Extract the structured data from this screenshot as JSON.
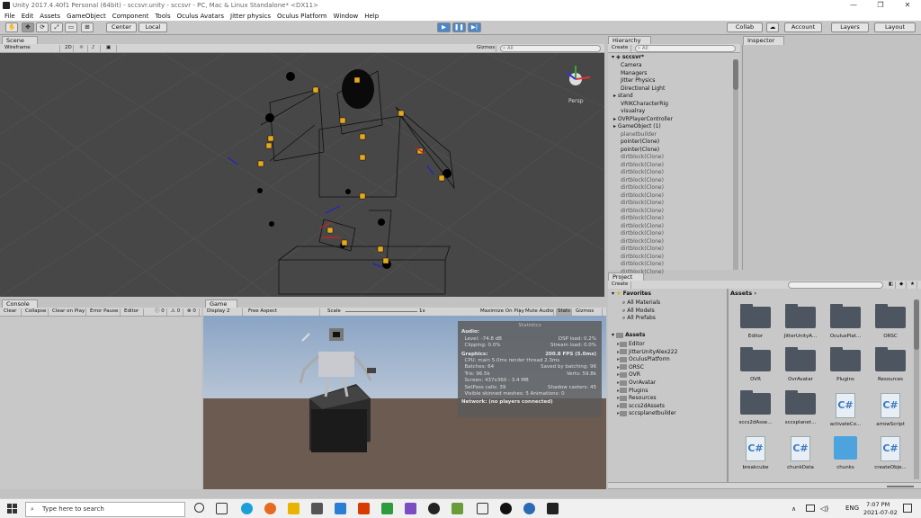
{
  "window": {
    "title": "Unity 2017.4.40f1 Personal (64bit) - sccsvr.unity - sccsvr - PC, Mac & Linux Standalone* <DX11>"
  },
  "menu": [
    "File",
    "Edit",
    "Assets",
    "GameObject",
    "Component",
    "Tools",
    "Oculus Avatars",
    "Jitter physics",
    "Oculus Platform",
    "Window",
    "Help"
  ],
  "toolbar": {
    "center": "Center",
    "local": "Local",
    "collab": "Collab",
    "account": "Account",
    "layers": "Layers",
    "layout": "Layout"
  },
  "scene": {
    "tab": "Scene",
    "shading": "Wireframe",
    "mode2d": "2D",
    "gizmos": "Gizmos",
    "search_placeholder": "All",
    "persp": "Persp"
  },
  "console": {
    "tab": "Console",
    "clear": "Clear",
    "collapse": "Collapse",
    "clear_on_play": "Clear on Play",
    "error_pause": "Error Pause",
    "editor": "Editor",
    "count_info": "0",
    "count_warn": "0",
    "count_err": "0"
  },
  "game": {
    "tab": "Game",
    "display": "Display 2",
    "aspect": "Free Aspect",
    "scale_label": "Scale",
    "scale_value": "1x",
    "maximize": "Maximize On Play",
    "mute": "Mute Audio",
    "stats": "Stats",
    "gizmos": "Gizmos"
  },
  "statistics": {
    "title": "Statistics",
    "audio": "Audio:",
    "level": "Level: -74.8 dB",
    "dsp": "DSP load: 0.2%",
    "clipping": "Clipping: 0.0%",
    "stream": "Stream load: 0.0%",
    "graphics": "Graphics:",
    "fps": "200.8 FPS (5.0ms)",
    "cpu": "CPU: main 5.0ms  render thread 2.3ms",
    "batches": "Batches: 64",
    "saved": "Saved by batching: 96",
    "tris": "Tris: 96.5k",
    "verts": "Verts: 59.8k",
    "screen": "Screen: 437x360 - 3.4 MB",
    "setpass": "SetPass calls: 39",
    "shadow": "Shadow casters: 45",
    "skinned": "Visible skinned meshes: 5  Animations: 0",
    "network": "Network: (no players connected)"
  },
  "hierarchy": {
    "tab": "Hierarchy",
    "create": "Create",
    "search_placeholder": "All",
    "scene_name": "sccsvr*",
    "items": [
      "Camera",
      "Managers",
      "Jitter Physics",
      "Directional Light",
      "stand",
      "VRIKCharacterRig",
      "visualray",
      "OVRPlayerController",
      "GameObject (1)",
      "planetbuilder",
      "pointer(Clone)",
      "pointer(Clone)",
      "dirtblock(Clone)",
      "dirtblock(Clone)",
      "dirtblock(Clone)",
      "dirtblock(Clone)",
      "dirtblock(Clone)",
      "dirtblock(Clone)",
      "dirtblock(Clone)",
      "dirtblock(Clone)",
      "dirtblock(Clone)",
      "dirtblock(Clone)",
      "dirtblock(Clone)",
      "dirtblock(Clone)",
      "dirtblock(Clone)",
      "dirtblock(Clone)",
      "dirtblock(Clone)",
      "dirtblock(Clone)"
    ]
  },
  "inspector": {
    "tab": "Inspector"
  },
  "project": {
    "tab": "Project",
    "create": "Create",
    "favorites": "Favorites",
    "fav_items": [
      "All Materials",
      "All Models",
      "All Prefabs"
    ],
    "assets_root": "Assets",
    "folders": [
      "Editor",
      "JitterUnityAlex222",
      "OculusPlatform",
      "ORSC",
      "OVR",
      "OvrAvatar",
      "Plugins",
      "Resources",
      "sccs2dAssets",
      "sccsplanetbuilder"
    ],
    "breadcrumb": "Assets",
    "grid": [
      "Editor",
      "JitterUnityA...",
      "OculusPlat...",
      "ORSC",
      "OVR",
      "OvrAvatar",
      "Plugins",
      "Resources",
      "sccs2dAsse...",
      "sccsplanet...",
      "activateCo...",
      "arrowScript",
      "breakcube",
      "chunkData",
      "chunks",
      "createObje..."
    ]
  },
  "taskbar": {
    "search_placeholder": "Type here to search",
    "lang": "ENG",
    "time": "7:07 PM",
    "date": "2021-07-02"
  }
}
